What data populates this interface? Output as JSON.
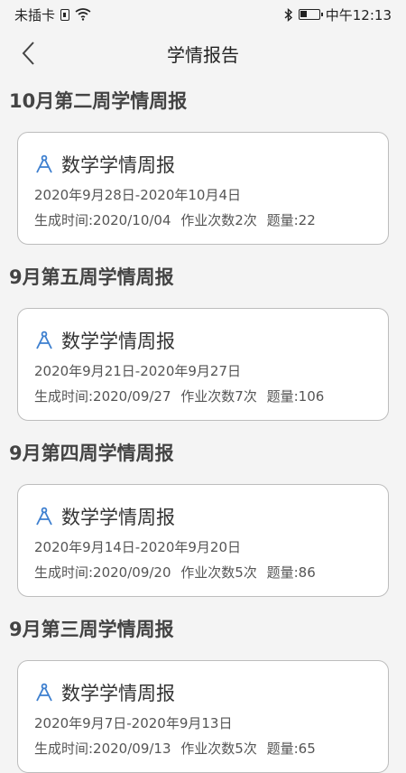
{
  "status_bar": {
    "carrier": "未插卡",
    "time": "中午12:13"
  },
  "header": {
    "title": "学情报告"
  },
  "reports": [
    {
      "week_title": "10月第二周学情周报",
      "subject": "数学学情周报",
      "date_range": "2020年9月28日-2020年10月4日",
      "generated": "生成时间:2020/10/04",
      "homework": "作业次数2次",
      "questions": "题量:22"
    },
    {
      "week_title": "9月第五周学情周报",
      "subject": "数学学情周报",
      "date_range": "2020年9月21日-2020年9月27日",
      "generated": "生成时间:2020/09/27",
      "homework": "作业次数7次",
      "questions": "题量:106"
    },
    {
      "week_title": "9月第四周学情周报",
      "subject": "数学学情周报",
      "date_range": "2020年9月14日-2020年9月20日",
      "generated": "生成时间:2020/09/20",
      "homework": "作业次数5次",
      "questions": "题量:86"
    },
    {
      "week_title": "9月第三周学情周报",
      "subject": "数学学情周报",
      "date_range": "2020年9月7日-2020年9月13日",
      "generated": "生成时间:2020/09/13",
      "homework": "作业次数5次",
      "questions": "题量:65"
    }
  ],
  "icons": {
    "subject": "compass-icon",
    "back": "chevron-left-icon"
  },
  "colors": {
    "accent": "#3d7fcf",
    "background": "#f4f4f4"
  }
}
